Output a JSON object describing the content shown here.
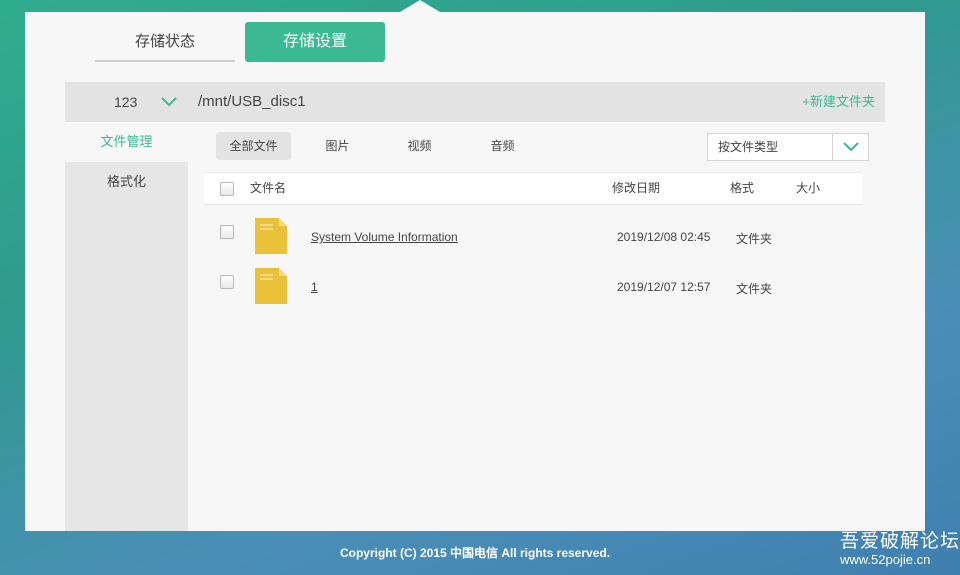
{
  "tabs": {
    "status_label": "存储状态",
    "settings_label": "存储设置"
  },
  "pathbar": {
    "disk": "123",
    "path": "/mnt/USB_disc1",
    "new_folder": "+新建文件夹"
  },
  "sidebar": {
    "items": [
      {
        "label": "文件管理"
      },
      {
        "label": "格式化"
      }
    ]
  },
  "filters": {
    "items": [
      {
        "label": "全部文件"
      },
      {
        "label": "图片"
      },
      {
        "label": "视频"
      },
      {
        "label": "音频"
      }
    ]
  },
  "sort": {
    "selected": "按文件类型"
  },
  "table": {
    "headers": {
      "name": "文件名",
      "date": "修改日期",
      "type": "格式",
      "size": "大小"
    },
    "rows": [
      {
        "name": "System Volume Information",
        "date": "2019/12/08 02:45",
        "type": "文件夹",
        "size": ""
      },
      {
        "name": "1",
        "date": "2019/12/07 12:57",
        "type": "文件夹",
        "size": ""
      }
    ]
  },
  "footer": {
    "copyright": "Copyright (C) 2015 中国电信 All rights reserved."
  },
  "watermark": {
    "line1": "吾爱破解论坛",
    "line2": "www.52pojie.cn"
  },
  "colors": {
    "accent": "#3bb992",
    "folder": "#e9c23a"
  },
  "icons": {
    "disk_dropdown": "chevron-down-icon",
    "sort_dropdown": "chevron-down-icon",
    "folder": "folder-icon"
  }
}
